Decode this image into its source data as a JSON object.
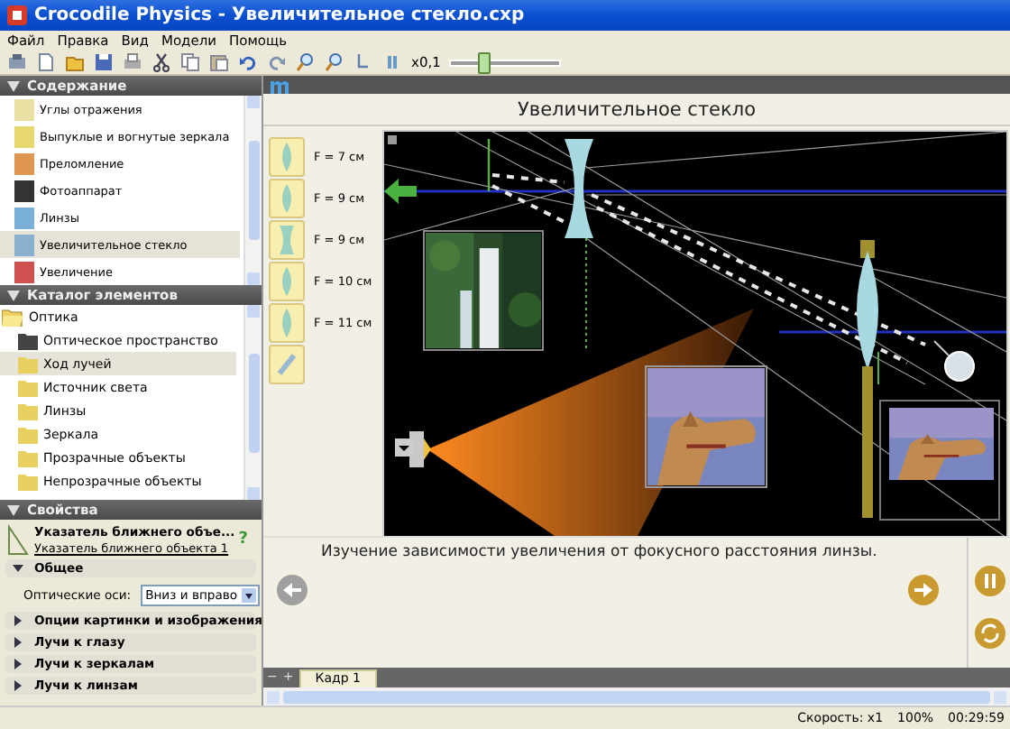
{
  "window": {
    "title": "Crocodile Physics - Увеличительное стекло.cxp"
  },
  "menu": [
    "Файл",
    "Правка",
    "Вид",
    "Модели",
    "Помощь"
  ],
  "toolbar": {
    "speed_label": "x0,1",
    "speed_slider": {
      "level": 0.3
    }
  },
  "contents": {
    "title": "Содержание",
    "items": [
      {
        "label": "Углы отражения",
        "selected": false
      },
      {
        "label": "Выпуклые и вогнутые зеркала",
        "selected": false
      },
      {
        "label": "Преломление",
        "selected": false
      },
      {
        "label": "Фотоаппарат",
        "selected": false
      },
      {
        "label": "Линзы",
        "selected": false
      },
      {
        "label": "Увеличительное стекло",
        "selected": true
      },
      {
        "label": "Увеличение",
        "selected": false
      }
    ]
  },
  "catalog": {
    "title": "Каталог элементов",
    "tree": [
      {
        "label": "Оптика",
        "expanded": true,
        "selected": false,
        "children": [
          {
            "label": "Оптическое пространство",
            "selected": false
          },
          {
            "label": "Ход лучей",
            "selected": true
          },
          {
            "label": "Источник света",
            "selected": false
          },
          {
            "label": "Линзы",
            "selected": false
          },
          {
            "label": "Зеркала",
            "selected": false
          },
          {
            "label": "Прозрачные объекты",
            "selected": false
          },
          {
            "label": "Непрозрачные объекты",
            "selected": false
          }
        ]
      }
    ]
  },
  "properties": {
    "title": "Свойства",
    "object_name": "Указатель ближнего объе...",
    "object_link": "Указатель ближнего объекта 1",
    "help": "?",
    "sections": [
      {
        "label": "Общее",
        "expanded": true,
        "fields": [
          {
            "label": "Оптические оси:",
            "value": "Вниз и вправо"
          }
        ]
      },
      {
        "label": "Опции картинки и изображения",
        "expanded": false
      },
      {
        "label": "Лучи к глазу",
        "expanded": false
      },
      {
        "label": "Лучи к зеркалам",
        "expanded": false
      },
      {
        "label": "Лучи к линзам",
        "expanded": false
      }
    ]
  },
  "main": {
    "title": "Увеличительное стекло",
    "lens_buttons": [
      {
        "label": "F = 7 см",
        "kind": "convex"
      },
      {
        "label": "F = 9 см",
        "kind": "convex"
      },
      {
        "label": "F = 9 см",
        "kind": "concave"
      },
      {
        "label": "F = 10 см",
        "kind": "convex"
      },
      {
        "label": "F = 11 см",
        "kind": "convex"
      }
    ],
    "caption": "Изучение зависимости увеличения от фокусного расстояния линзы."
  },
  "frames": {
    "controls": [
      "−",
      "+"
    ],
    "tabs": [
      {
        "label": "Кадр 1",
        "selected": true
      }
    ]
  },
  "status_bar": {
    "speed": "Скорость: x1",
    "zoom": "100%",
    "time": "00:29:59"
  }
}
